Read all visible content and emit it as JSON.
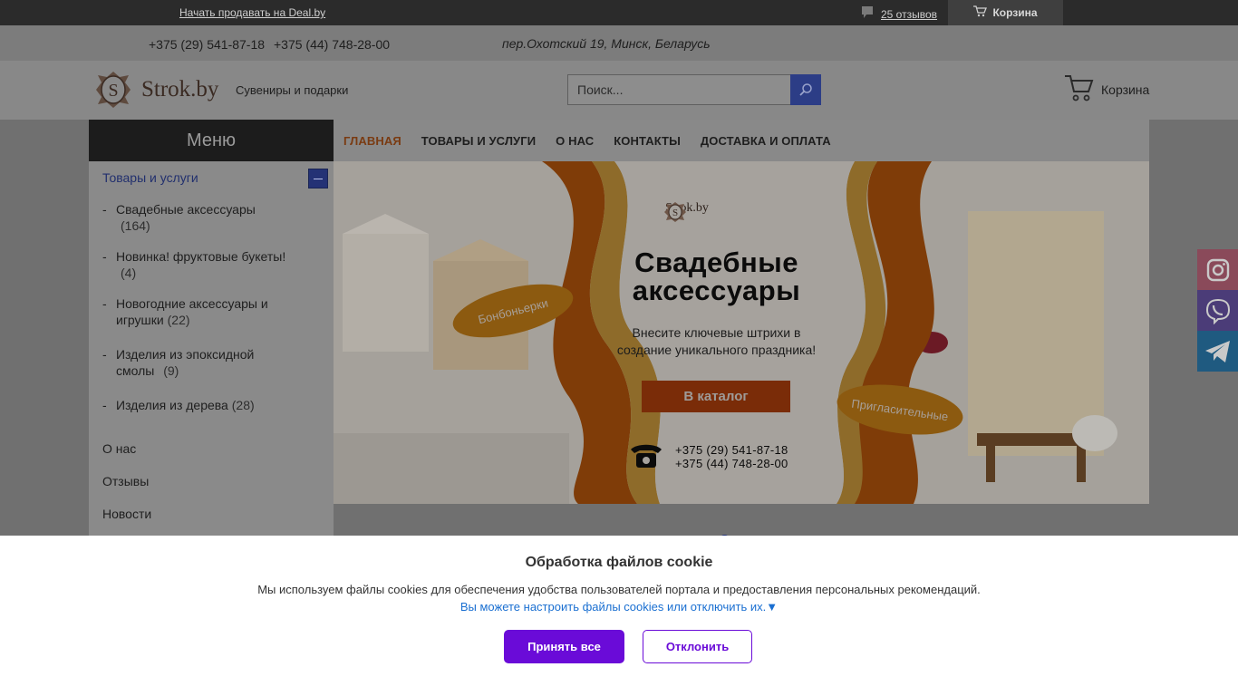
{
  "topbar": {
    "sell_link": "Начать продавать на Deal.by",
    "reviews": "25 отзывов",
    "cart": "Корзина"
  },
  "contacts": {
    "phone1": "+375 (29) 541-87-18",
    "phone2": "+375 (44) 748-28-00",
    "address": "пер.Охотский 19, Минск, Беларусь"
  },
  "header": {
    "logo_text": "Strok.by",
    "tagline": "Сувениры и подарки",
    "search_placeholder": "Поиск...",
    "cart_label": "Корзина"
  },
  "sidebar": {
    "title": "Меню",
    "category": "Товары и услуги",
    "subcategories": [
      {
        "name": "Свадебные аксессуары",
        "count": "(164)"
      },
      {
        "name": "Новинка! фруктовые букеты!",
        "count": "(4)"
      },
      {
        "name": "Новогодние аксессуары и игрушки",
        "count": "(22)"
      },
      {
        "name": "Изделия из эпоксидной смолы",
        "count": "(9)"
      },
      {
        "name": "Изделия из дерева",
        "count": "(28)"
      }
    ],
    "links": [
      "О нас",
      "Отзывы",
      "Новости"
    ]
  },
  "nav": {
    "items": [
      "ГЛАВНАЯ",
      "ТОВАРЫ И УСЛУГИ",
      "О НАС",
      "КОНТАКТЫ",
      "ДОСТАВКА И ОПЛАТА"
    ]
  },
  "banner": {
    "logo": "Strok.by",
    "title_line1": "Свадебные",
    "title_line2": "аксессуары",
    "subtitle_line1": "Внесите ключевые штрихи в",
    "subtitle_line2": "создание уникального праздника!",
    "button": "В каталог",
    "phone1": "+375 (29) 541-87-18",
    "phone2": "+375 (44) 748-28-00",
    "label_left": "Бонбоньерки",
    "label_right": "Пригласительные"
  },
  "social": [
    "instagram-icon",
    "viber-icon",
    "telegram-icon"
  ],
  "cookie": {
    "title": "Обработка файлов cookie",
    "text": "Мы используем файлы cookies для обеспечения удобства пользователей портала и предоставления персональных рекомендаций.",
    "settings_link": "Вы можете настроить файлы cookies или отключить их.▼",
    "accept": "Принять все",
    "decline": "Отклонить"
  },
  "colors": {
    "accent": "#6a0bd8",
    "link": "#1a6fd1",
    "nav_active": "#d35400",
    "banner_orange": "#e67e22"
  }
}
